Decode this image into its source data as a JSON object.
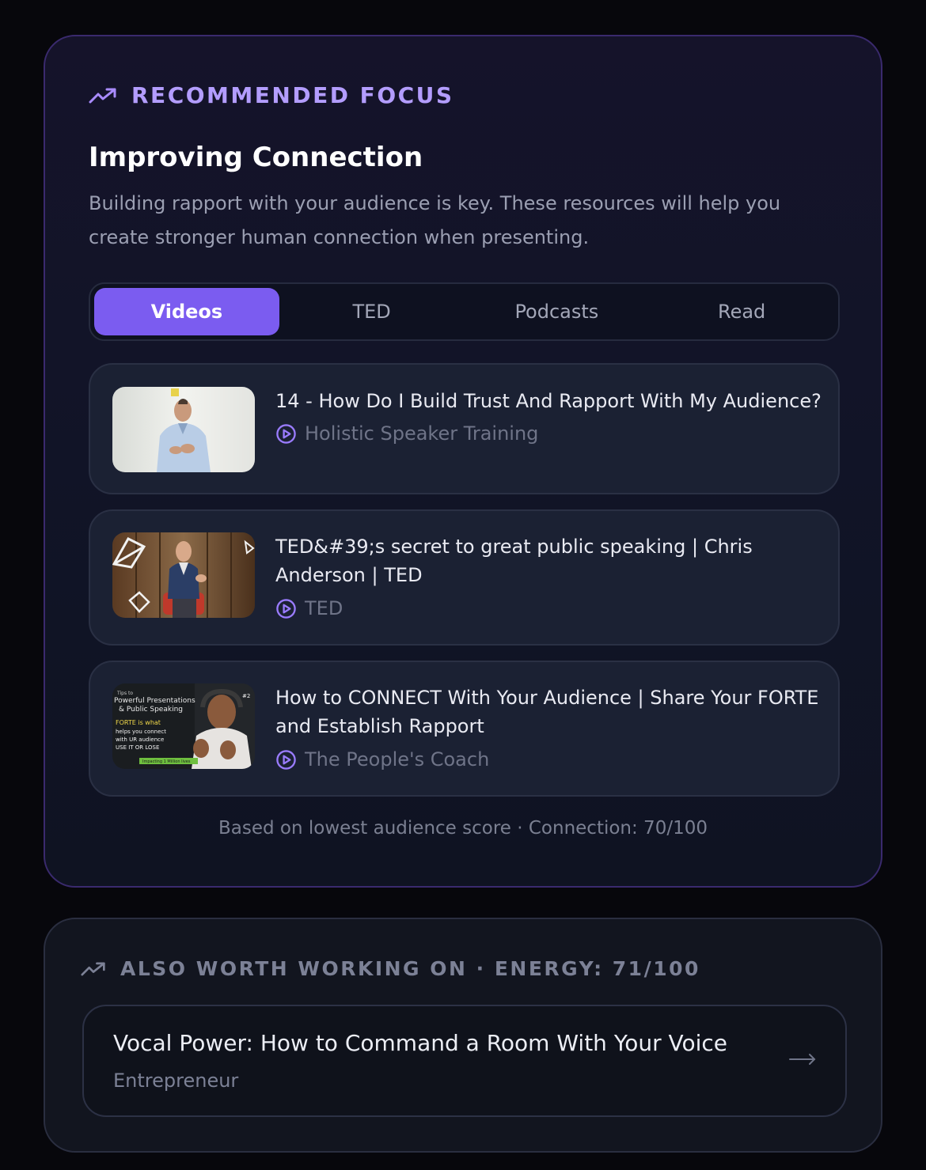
{
  "focus": {
    "eyebrow": "RECOMMENDED FOCUS",
    "eyebrow_icon": "trending-up-icon",
    "title": "Improving Connection",
    "description": "Building rapport with your audience is key. These resources will help you create stronger human connection when presenting.",
    "tabs": [
      {
        "label": "Videos",
        "active": true
      },
      {
        "label": "TED",
        "active": false
      },
      {
        "label": "Podcasts",
        "active": false
      },
      {
        "label": "Read",
        "active": false
      }
    ],
    "items": [
      {
        "title": "14 - How Do I Build Trust And Rapport With My Audience?",
        "source": "Holistic Speaker Training"
      },
      {
        "title": "TED&#39;s secret to great public speaking | Chris Anderson | TED",
        "source": "TED"
      },
      {
        "title": "How to CONNECT With Your Audience | Share Your FORTE and Establish Rapport",
        "source": "The People's Coach"
      }
    ],
    "thumb3_text": {
      "line1": "Tips to",
      "line2": "Powerful Presentations",
      "line3": "& Public Speaking",
      "line4": "FORTE is what",
      "line5": "helps you connect",
      "line6": "with UR audience",
      "line7": "USE IT OR LOSE",
      "badge": "#2",
      "banner": "Impacting 1 Million lives"
    },
    "footnote": "Based on lowest audience score · Connection: 70/100"
  },
  "also": {
    "eyebrow": "ALSO WORTH WORKING ON · ENERGY: 71/100",
    "eyebrow_icon": "trending-up-icon",
    "item_title": "Vocal Power: How to Command a Room With Your Voice",
    "item_source": "Entrepreneur",
    "arrow_icon": "arrow-right-icon"
  },
  "colors": {
    "accent": "#7b5cf0",
    "eyebrow": "#b39dff",
    "background": "#07070c"
  }
}
